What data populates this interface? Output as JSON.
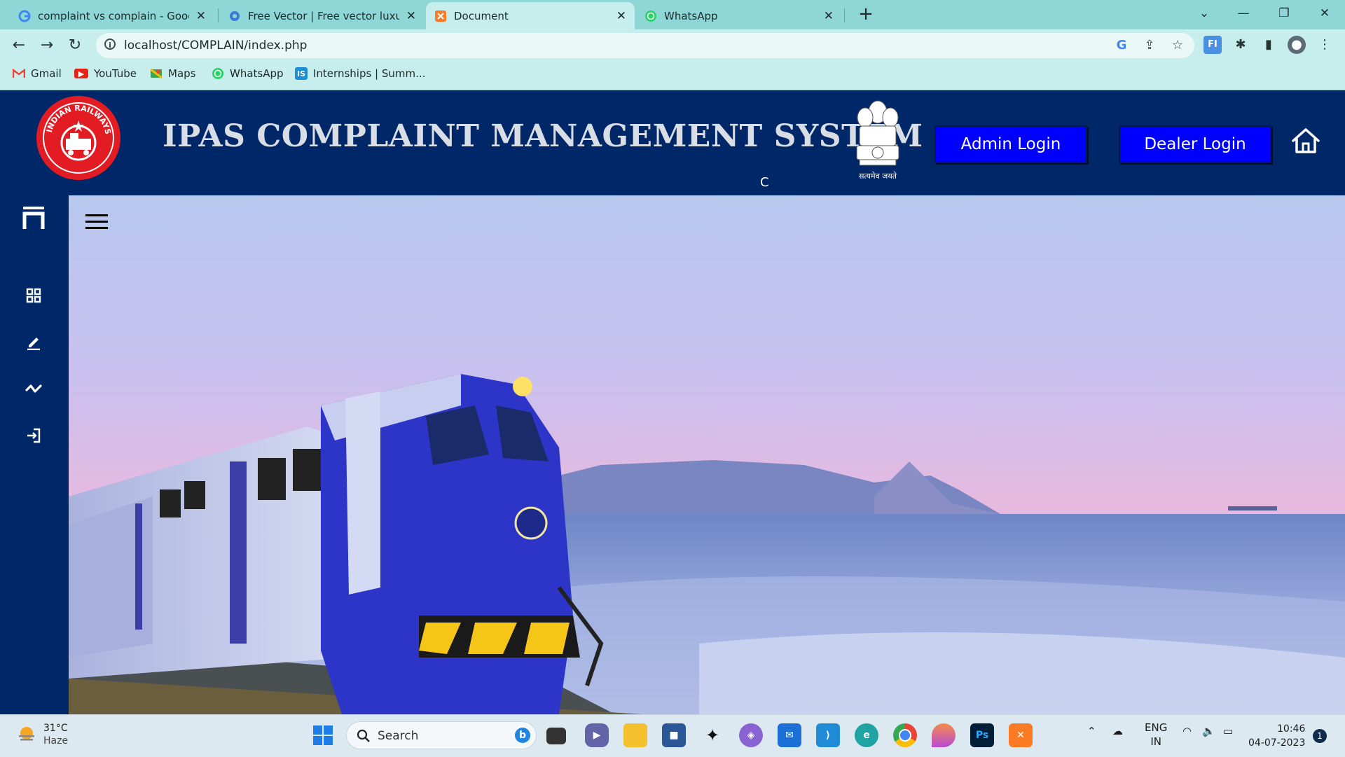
{
  "browser": {
    "tabs": [
      {
        "title": "complaint vs complain - Google",
        "icon": "google-icon"
      },
      {
        "title": "Free Vector | Free vector luxury b",
        "icon": "freepik-icon"
      },
      {
        "title": "Document",
        "icon": "xampp-icon"
      },
      {
        "title": "WhatsApp",
        "icon": "whatsapp-icon"
      }
    ],
    "url": "localhost/COMPLAIN/index.php",
    "bookmarks": [
      {
        "label": "Gmail",
        "icon": "gmail-icon"
      },
      {
        "label": "YouTube",
        "icon": "youtube-icon"
      },
      {
        "label": "Maps",
        "icon": "maps-icon"
      },
      {
        "label": "WhatsApp",
        "icon": "whatsapp-icon"
      },
      {
        "label": "Internships | Summ...",
        "icon": "internshala-icon"
      }
    ]
  },
  "header": {
    "title": "IPAS COMPLAINT MANAGEMENT SYSTEM",
    "sub_char": "C",
    "logo_text": "INDIAN RAILWAYS",
    "emblem_text": "सत्यमेव जयते",
    "admin_login": "Admin Login",
    "dealer_login": "Dealer Login"
  },
  "sidebar": {
    "items": [
      "logo-icon",
      "dashboard-icon",
      "edit-icon",
      "activity-icon",
      "logout-icon"
    ]
  },
  "taskbar": {
    "weather_temp": "31°C",
    "weather_desc": "Haze",
    "search_label": "Search",
    "lang_1": "ENG",
    "lang_2": "IN",
    "time": "10:46",
    "date": "04-07-2023",
    "notifications": "1"
  },
  "colors": {
    "header_bg": "#002868",
    "login_button": "#0000ff",
    "tab_strip": "#8fd6d6"
  }
}
